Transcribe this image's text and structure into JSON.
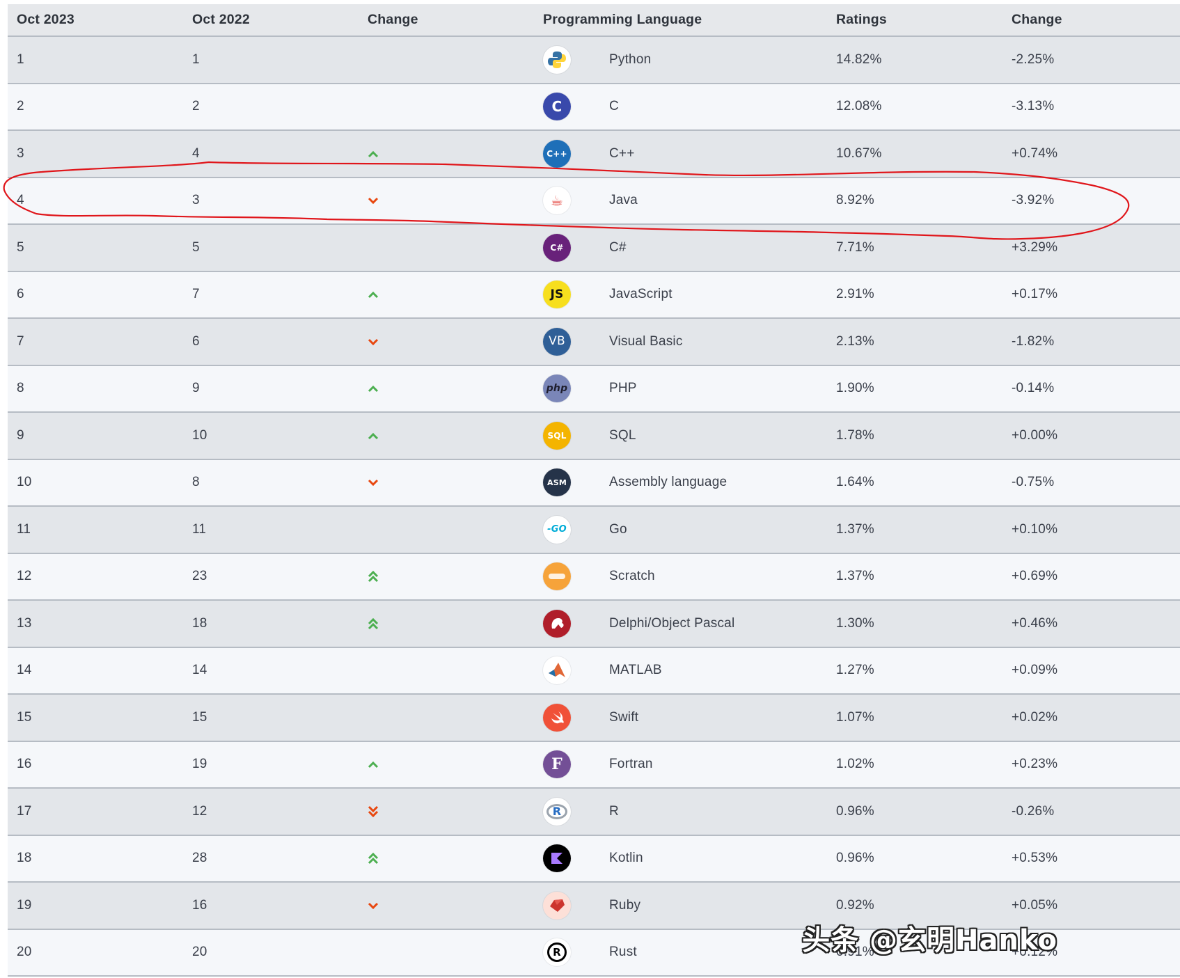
{
  "header": {
    "col1": "Oct 2023",
    "col2": "Oct 2022",
    "col3": "Change",
    "col4": "Programming Language",
    "col5": "Ratings",
    "col6": "Change"
  },
  "rows": [
    {
      "rank": "1",
      "prev": "1",
      "trend": "none",
      "language": "Python",
      "rating": "14.82%",
      "change": "-2.25%",
      "icon": "python-icon",
      "logo_text": "",
      "logo_bg": "#ffffff",
      "logo_fg": "#3572a5"
    },
    {
      "rank": "2",
      "prev": "2",
      "trend": "none",
      "language": "C",
      "rating": "12.08%",
      "change": "-3.13%",
      "icon": "c-icon",
      "logo_text": "C",
      "logo_bg": "#3949ab",
      "logo_fg": "#ffffff"
    },
    {
      "rank": "3",
      "prev": "4",
      "trend": "up",
      "language": "C++",
      "rating": "10.67%",
      "change": "+0.74%",
      "icon": "cpp-icon",
      "logo_text": "C++",
      "logo_bg": "#1e6fb8",
      "logo_fg": "#ffffff"
    },
    {
      "rank": "4",
      "prev": "3",
      "trend": "down",
      "language": "Java",
      "rating": "8.92%",
      "change": "-3.92%",
      "icon": "java-icon",
      "logo_text": "☕",
      "logo_bg": "#ffffff",
      "logo_fg": "#e1312a"
    },
    {
      "rank": "5",
      "prev": "5",
      "trend": "none",
      "language": "C#",
      "rating": "7.71%",
      "change": "+3.29%",
      "icon": "csharp-icon",
      "logo_text": "C#",
      "logo_bg": "#68217a",
      "logo_fg": "#ffffff"
    },
    {
      "rank": "6",
      "prev": "7",
      "trend": "up",
      "language": "JavaScript",
      "rating": "2.91%",
      "change": "+0.17%",
      "icon": "javascript-icon",
      "logo_text": "JS",
      "logo_bg": "#f7df1e",
      "logo_fg": "#111111"
    },
    {
      "rank": "7",
      "prev": "6",
      "trend": "down",
      "language": "Visual Basic",
      "rating": "2.13%",
      "change": "-1.82%",
      "icon": "visual-basic-icon",
      "logo_text": "VB",
      "logo_bg": "#2f5f97",
      "logo_fg": "#ffffff"
    },
    {
      "rank": "8",
      "prev": "9",
      "trend": "up",
      "language": "PHP",
      "rating": "1.90%",
      "change": "-0.14%",
      "icon": "php-icon",
      "logo_text": "php",
      "logo_bg": "#7a86b8",
      "logo_fg": "#1f1f2e"
    },
    {
      "rank": "9",
      "prev": "10",
      "trend": "up",
      "language": "SQL",
      "rating": "1.78%",
      "change": "+0.00%",
      "icon": "sql-icon",
      "logo_text": "SQL",
      "logo_bg": "#f4b400",
      "logo_fg": "#ffffff"
    },
    {
      "rank": "10",
      "prev": "8",
      "trend": "down",
      "language": "Assembly language",
      "rating": "1.64%",
      "change": "-0.75%",
      "icon": "assembly-icon",
      "logo_text": "ASM",
      "logo_bg": "#253349",
      "logo_fg": "#ffffff"
    },
    {
      "rank": "11",
      "prev": "11",
      "trend": "none",
      "language": "Go",
      "rating": "1.37%",
      "change": "+0.10%",
      "icon": "go-icon",
      "logo_text": "GO",
      "logo_bg": "#ffffff",
      "logo_fg": "#00acd7"
    },
    {
      "rank": "12",
      "prev": "23",
      "trend": "up2",
      "language": "Scratch",
      "rating": "1.37%",
      "change": "+0.69%",
      "icon": "scratch-icon",
      "logo_text": "",
      "logo_bg": "#f6a33a",
      "logo_fg": "#ffffff"
    },
    {
      "rank": "13",
      "prev": "18",
      "trend": "up2",
      "language": "Delphi/Object Pascal",
      "rating": "1.30%",
      "change": "+0.46%",
      "icon": "delphi-icon",
      "logo_text": "",
      "logo_bg": "#b01e2a",
      "logo_fg": "#ffffff"
    },
    {
      "rank": "14",
      "prev": "14",
      "trend": "none",
      "language": "MATLAB",
      "rating": "1.27%",
      "change": "+0.09%",
      "icon": "matlab-icon",
      "logo_text": "",
      "logo_bg": "#ffffff",
      "logo_fg": "#e16737"
    },
    {
      "rank": "15",
      "prev": "15",
      "trend": "none",
      "language": "Swift",
      "rating": "1.07%",
      "change": "+0.02%",
      "icon": "swift-icon",
      "logo_text": "",
      "logo_bg": "#f05138",
      "logo_fg": "#ffffff"
    },
    {
      "rank": "16",
      "prev": "19",
      "trend": "up",
      "language": "Fortran",
      "rating": "1.02%",
      "change": "+0.23%",
      "icon": "fortran-icon",
      "logo_text": "F",
      "logo_bg": "#734f96",
      "logo_fg": "#ffffff"
    },
    {
      "rank": "17",
      "prev": "12",
      "trend": "down2",
      "language": "R",
      "rating": "0.96%",
      "change": "-0.26%",
      "icon": "r-icon",
      "logo_text": "R",
      "logo_bg": "#ffffff",
      "logo_fg": "#276dc3"
    },
    {
      "rank": "18",
      "prev": "28",
      "trend": "up2",
      "language": "Kotlin",
      "rating": "0.96%",
      "change": "+0.53%",
      "icon": "kotlin-icon",
      "logo_text": "",
      "logo_bg": "#000000",
      "logo_fg": "#a97bff"
    },
    {
      "rank": "19",
      "prev": "16",
      "trend": "down",
      "language": "Ruby",
      "rating": "0.92%",
      "change": "+0.05%",
      "icon": "ruby-icon",
      "logo_text": "",
      "logo_bg": "#fde0d8",
      "logo_fg": "#cc342d"
    },
    {
      "rank": "20",
      "prev": "20",
      "trend": "none",
      "language": "Rust",
      "rating": "0.91%",
      "change": "+0.12%",
      "icon": "rust-icon",
      "logo_text": "R",
      "logo_bg": "#ffffff",
      "logo_fg": "#000000"
    }
  ],
  "colors": {
    "up": "#4caf50",
    "down": "#e8470f",
    "highlight_ring": "#e0161b"
  },
  "watermark": "头条 @玄明Hanko"
}
